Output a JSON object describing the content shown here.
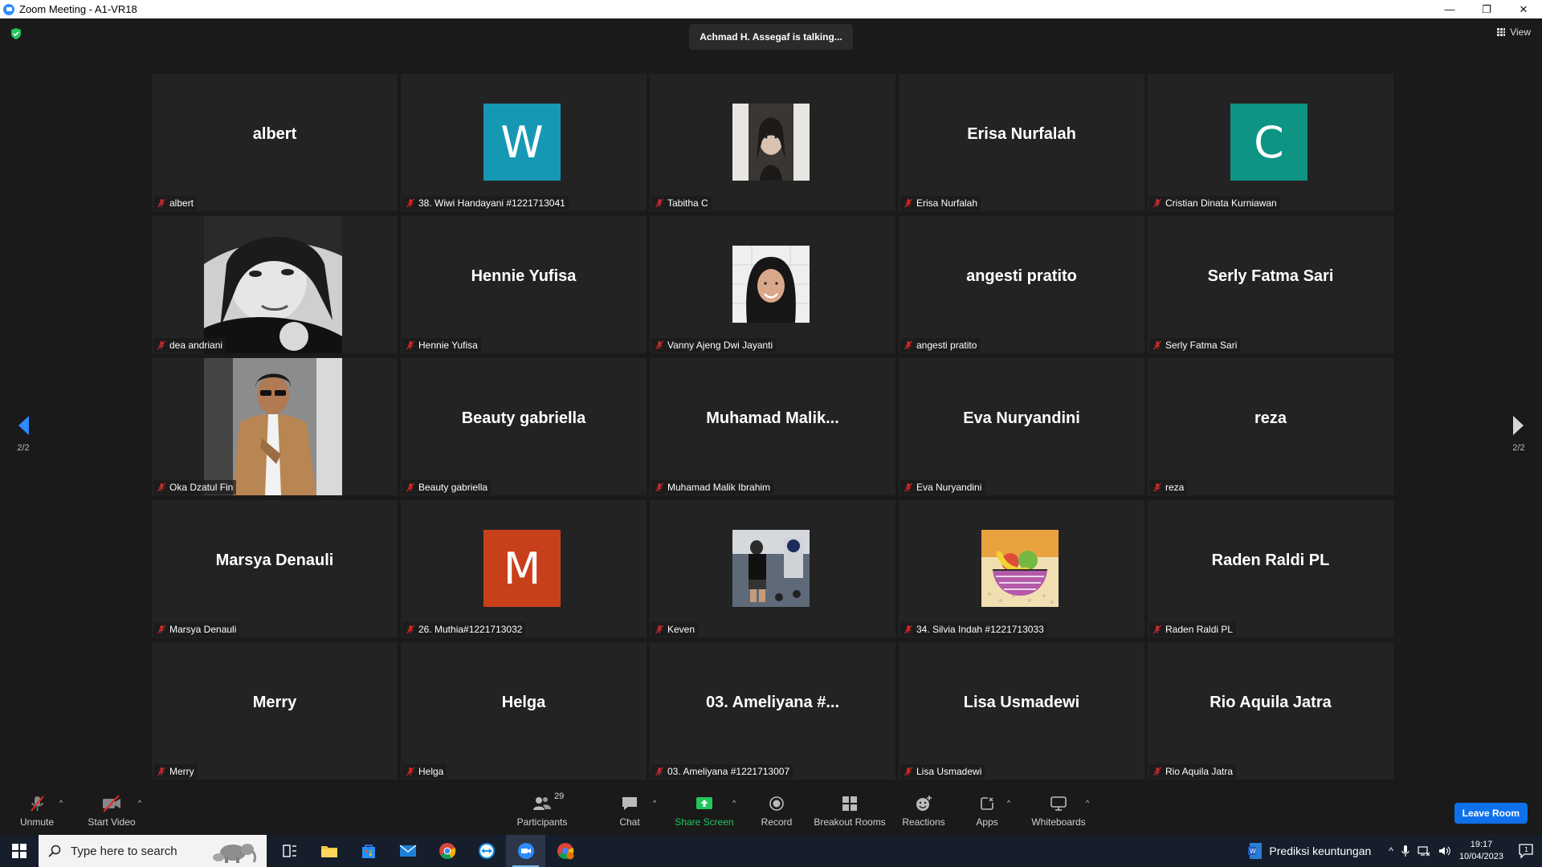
{
  "window": {
    "title": "Zoom Meeting - A1-VR18",
    "minimize": "—",
    "restore": "❐",
    "close": "✕"
  },
  "meeting": {
    "talking_text": "Achmad H. Assegaf is talking...",
    "view_label": "View",
    "page_left": "2/2",
    "page_right": "2/2"
  },
  "tiles": [
    {
      "label": "albert",
      "big": "albert",
      "kind": "name"
    },
    {
      "label": "38. Wiwi Handayani #1221713041",
      "kind": "avatar",
      "letter": "W",
      "color": "#1698b5"
    },
    {
      "label": "Tabitha C",
      "kind": "photo",
      "photo": "portrait-woman"
    },
    {
      "label": "Erisa Nurfalah",
      "big": "Erisa Nurfalah",
      "kind": "name"
    },
    {
      "label": "Cristian Dinata Kurniawan",
      "kind": "avatar",
      "letter": "C",
      "color": "#0e9483"
    },
    {
      "label": "dea andriani",
      "kind": "photo-lg",
      "photo": "selfie-bw"
    },
    {
      "label": "Hennie Yufisa",
      "big": "Hennie Yufisa",
      "kind": "name"
    },
    {
      "label": "Vanny Ajeng Dwi Jayanti",
      "kind": "photo",
      "photo": "hijab-woman"
    },
    {
      "label": "angesti pratito",
      "big": "angesti pratito",
      "kind": "name"
    },
    {
      "label": "Serly Fatma Sari",
      "big": "Serly Fatma Sari",
      "kind": "name"
    },
    {
      "label": "Oka Dzatul Fin",
      "kind": "photo-lg",
      "photo": "man-jacket"
    },
    {
      "label": "Beauty gabriella",
      "big": "Beauty gabriella",
      "kind": "name"
    },
    {
      "label": "Muhamad Malik Ibrahim",
      "big": "Muhamad  Malik...",
      "kind": "name"
    },
    {
      "label": "Eva Nuryandini",
      "big": "Eva Nuryandini",
      "kind": "name"
    },
    {
      "label": "reza",
      "big": "reza",
      "kind": "name"
    },
    {
      "label": "Marsya Denauli",
      "big": "Marsya Denauli",
      "kind": "name"
    },
    {
      "label": "26. Muthia#1221713032",
      "kind": "avatar",
      "letter": "M",
      "color": "#c8401a"
    },
    {
      "label": "Keven",
      "kind": "photo",
      "photo": "gym"
    },
    {
      "label": "34. Silvia Indah #1221713033",
      "kind": "photo",
      "photo": "fruit-bowl"
    },
    {
      "label": "Raden Raldi PL",
      "big": "Raden Raldi PL",
      "kind": "name"
    },
    {
      "label": "Merry",
      "big": "Merry",
      "kind": "name"
    },
    {
      "label": "Helga",
      "big": "Helga",
      "kind": "name"
    },
    {
      "label": "03. Ameliyana #1221713007",
      "big": "03. Ameliyana #...",
      "kind": "name"
    },
    {
      "label": "Lisa Usmadewi",
      "big": "Lisa Usmadewi",
      "kind": "name"
    },
    {
      "label": "Rio Aquila Jatra",
      "big": "Rio Aquila Jatra",
      "kind": "name"
    }
  ],
  "toolbar": {
    "unmute": "Unmute",
    "start_video": "Start Video",
    "participants": "Participants",
    "participants_count": "29",
    "chat": "Chat",
    "share_screen": "Share Screen",
    "record": "Record",
    "breakout_rooms": "Breakout Rooms",
    "reactions": "Reactions",
    "apps": "Apps",
    "whiteboards": "Whiteboards",
    "leave_room": "Leave Room"
  },
  "taskbar": {
    "search_placeholder": "Type here to search",
    "open_doc": "Prediksi keuntungan",
    "time": "19:17",
    "date": "10/04/2023",
    "notif_count": "1"
  },
  "colors": {
    "accent_blue": "#0e71eb",
    "share_green": "#22c55e",
    "mute_red": "#e02828"
  }
}
